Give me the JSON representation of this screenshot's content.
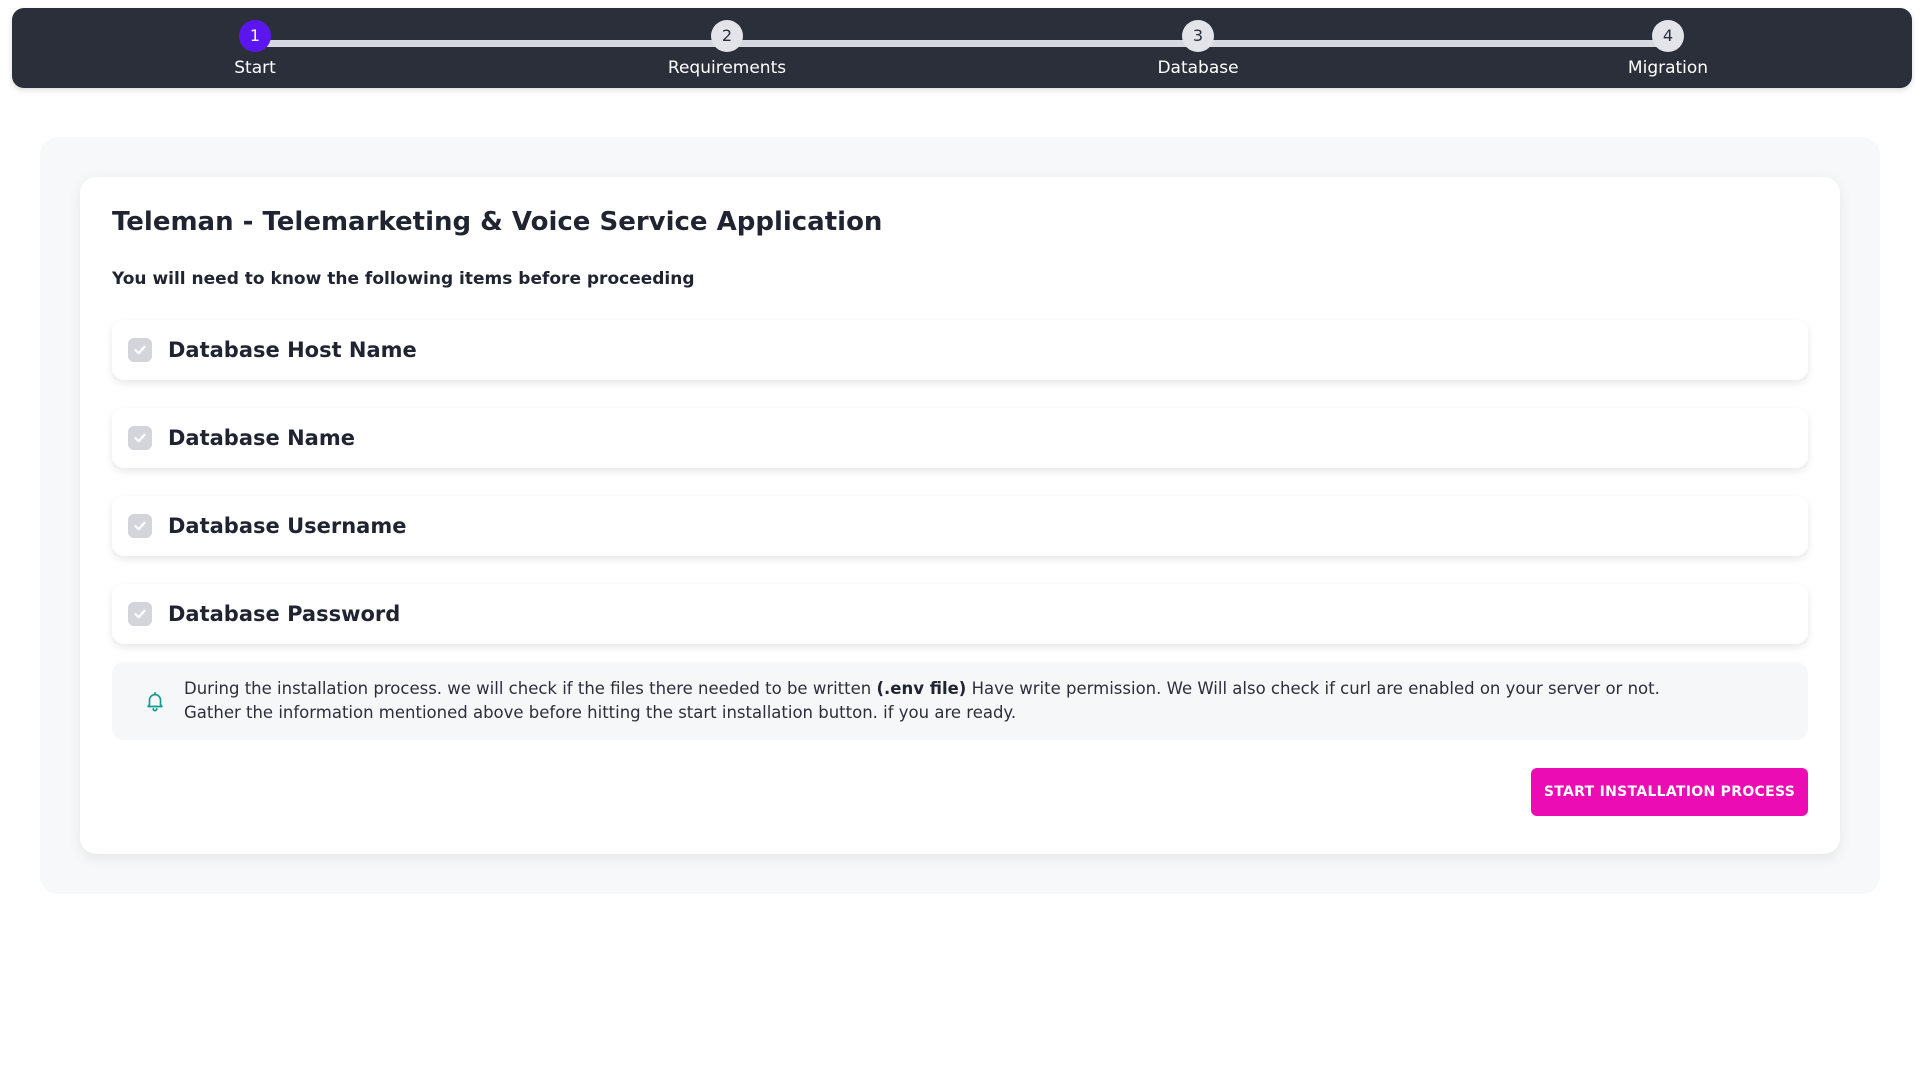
{
  "stepper": {
    "steps": [
      {
        "number": "1",
        "label": "Start",
        "active": true
      },
      {
        "number": "2",
        "label": "Requirements",
        "active": false
      },
      {
        "number": "3",
        "label": "Database",
        "active": false
      },
      {
        "number": "4",
        "label": "Migration",
        "active": false
      }
    ],
    "active_color": "#5b16f0"
  },
  "card": {
    "title": "Teleman - Telemarketing & Voice Service Application",
    "subtitle": "You will need to know the following items before proceeding",
    "requirements": [
      {
        "label": "Database Host Name",
        "icon": "check-icon"
      },
      {
        "label": "Database Name",
        "icon": "check-icon"
      },
      {
        "label": "Database Username",
        "icon": "check-icon"
      },
      {
        "label": "Database Password",
        "icon": "check-icon"
      }
    ],
    "notice": {
      "icon": "bell-icon",
      "text_before": "During the installation process. we will check if the files there needed to be written ",
      "highlight": "(.env file)",
      "text_after": " Have write permission. We Will also check if curl are enabled on your server or not. Gather the information mentioned above before hitting the start installation button. if you are ready."
    },
    "start_button": {
      "label": "START INSTALLATION PROCESS",
      "color": "#ec0cb4"
    }
  }
}
